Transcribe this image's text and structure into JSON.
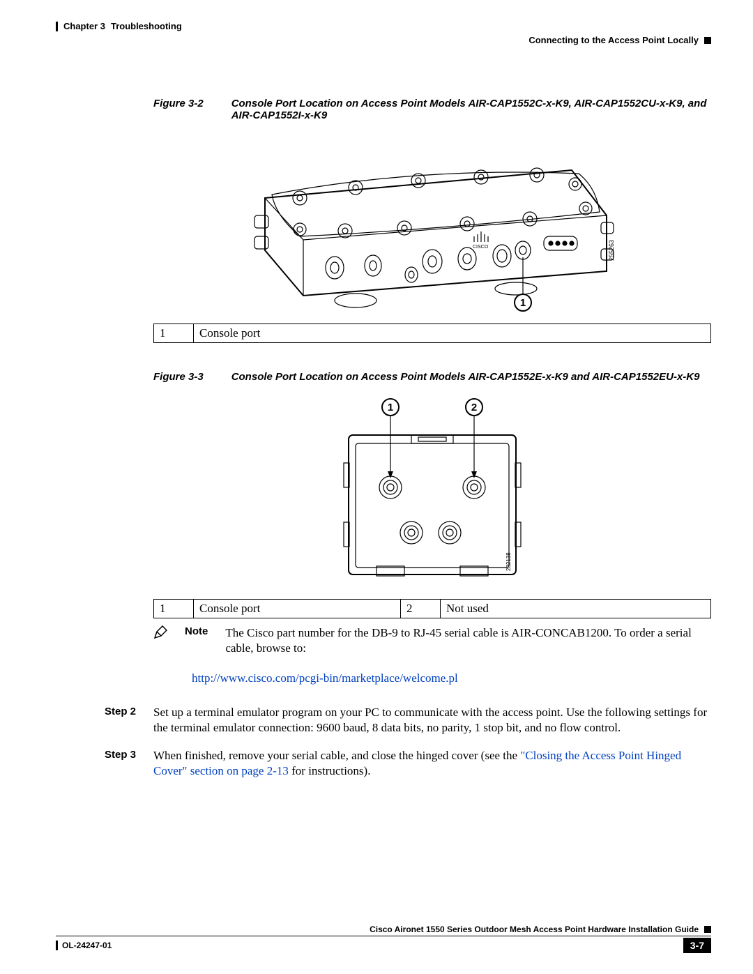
{
  "header": {
    "chapter_label": "Chapter 3",
    "chapter_title": "Troubleshooting",
    "section_title": "Connecting to the Access Point Locally"
  },
  "figure_a": {
    "label": "Figure 3-2",
    "title": "Console Port Location on Access Point Models AIR-CAP1552C-x-K9, AIR-CAP1552CU-x-K9, and AIR-CAP1552I-x-K9",
    "drawing_number": "255263",
    "callouts": [
      {
        "num": "1",
        "text": "Console port"
      }
    ],
    "logo_text": "CISCO"
  },
  "figure_b": {
    "label": "Figure 3-3",
    "title": "Console Port Location on Access Point Models AIR-CAP1552E-x-K9 and AIR-CAP1552EU-x-K9",
    "drawing_number": "282138",
    "callouts": [
      {
        "num": "1",
        "text": "Console port"
      },
      {
        "num": "2",
        "text": "Not used"
      }
    ]
  },
  "note": {
    "label": "Note",
    "text": "The Cisco part number for the DB-9 to RJ-45 serial cable is AIR-CONCAB1200. To order a serial cable, browse to:",
    "url": "http://www.cisco.com/pcgi-bin/marketplace/welcome.pl"
  },
  "steps": [
    {
      "label": "Step 2",
      "text": "Set up a terminal emulator program on your PC to communicate with the access point. Use the following settings for the terminal emulator connection: 9600 baud, 8 data bits, no parity, 1 stop bit, and no flow control.",
      "link_text": "",
      "suffix": ""
    },
    {
      "label": "Step 3",
      "text": "When finished, remove your serial cable, and close the hinged cover (see the ",
      "link_text": "\"Closing the Access Point Hinged Cover\" section on page 2-13",
      "suffix": " for instructions)."
    }
  ],
  "footer": {
    "guide_title": "Cisco Aironet 1550 Series Outdoor Mesh Access Point Hardware Installation Guide",
    "doc_id": "OL-24247-01",
    "page_number": "3-7"
  }
}
